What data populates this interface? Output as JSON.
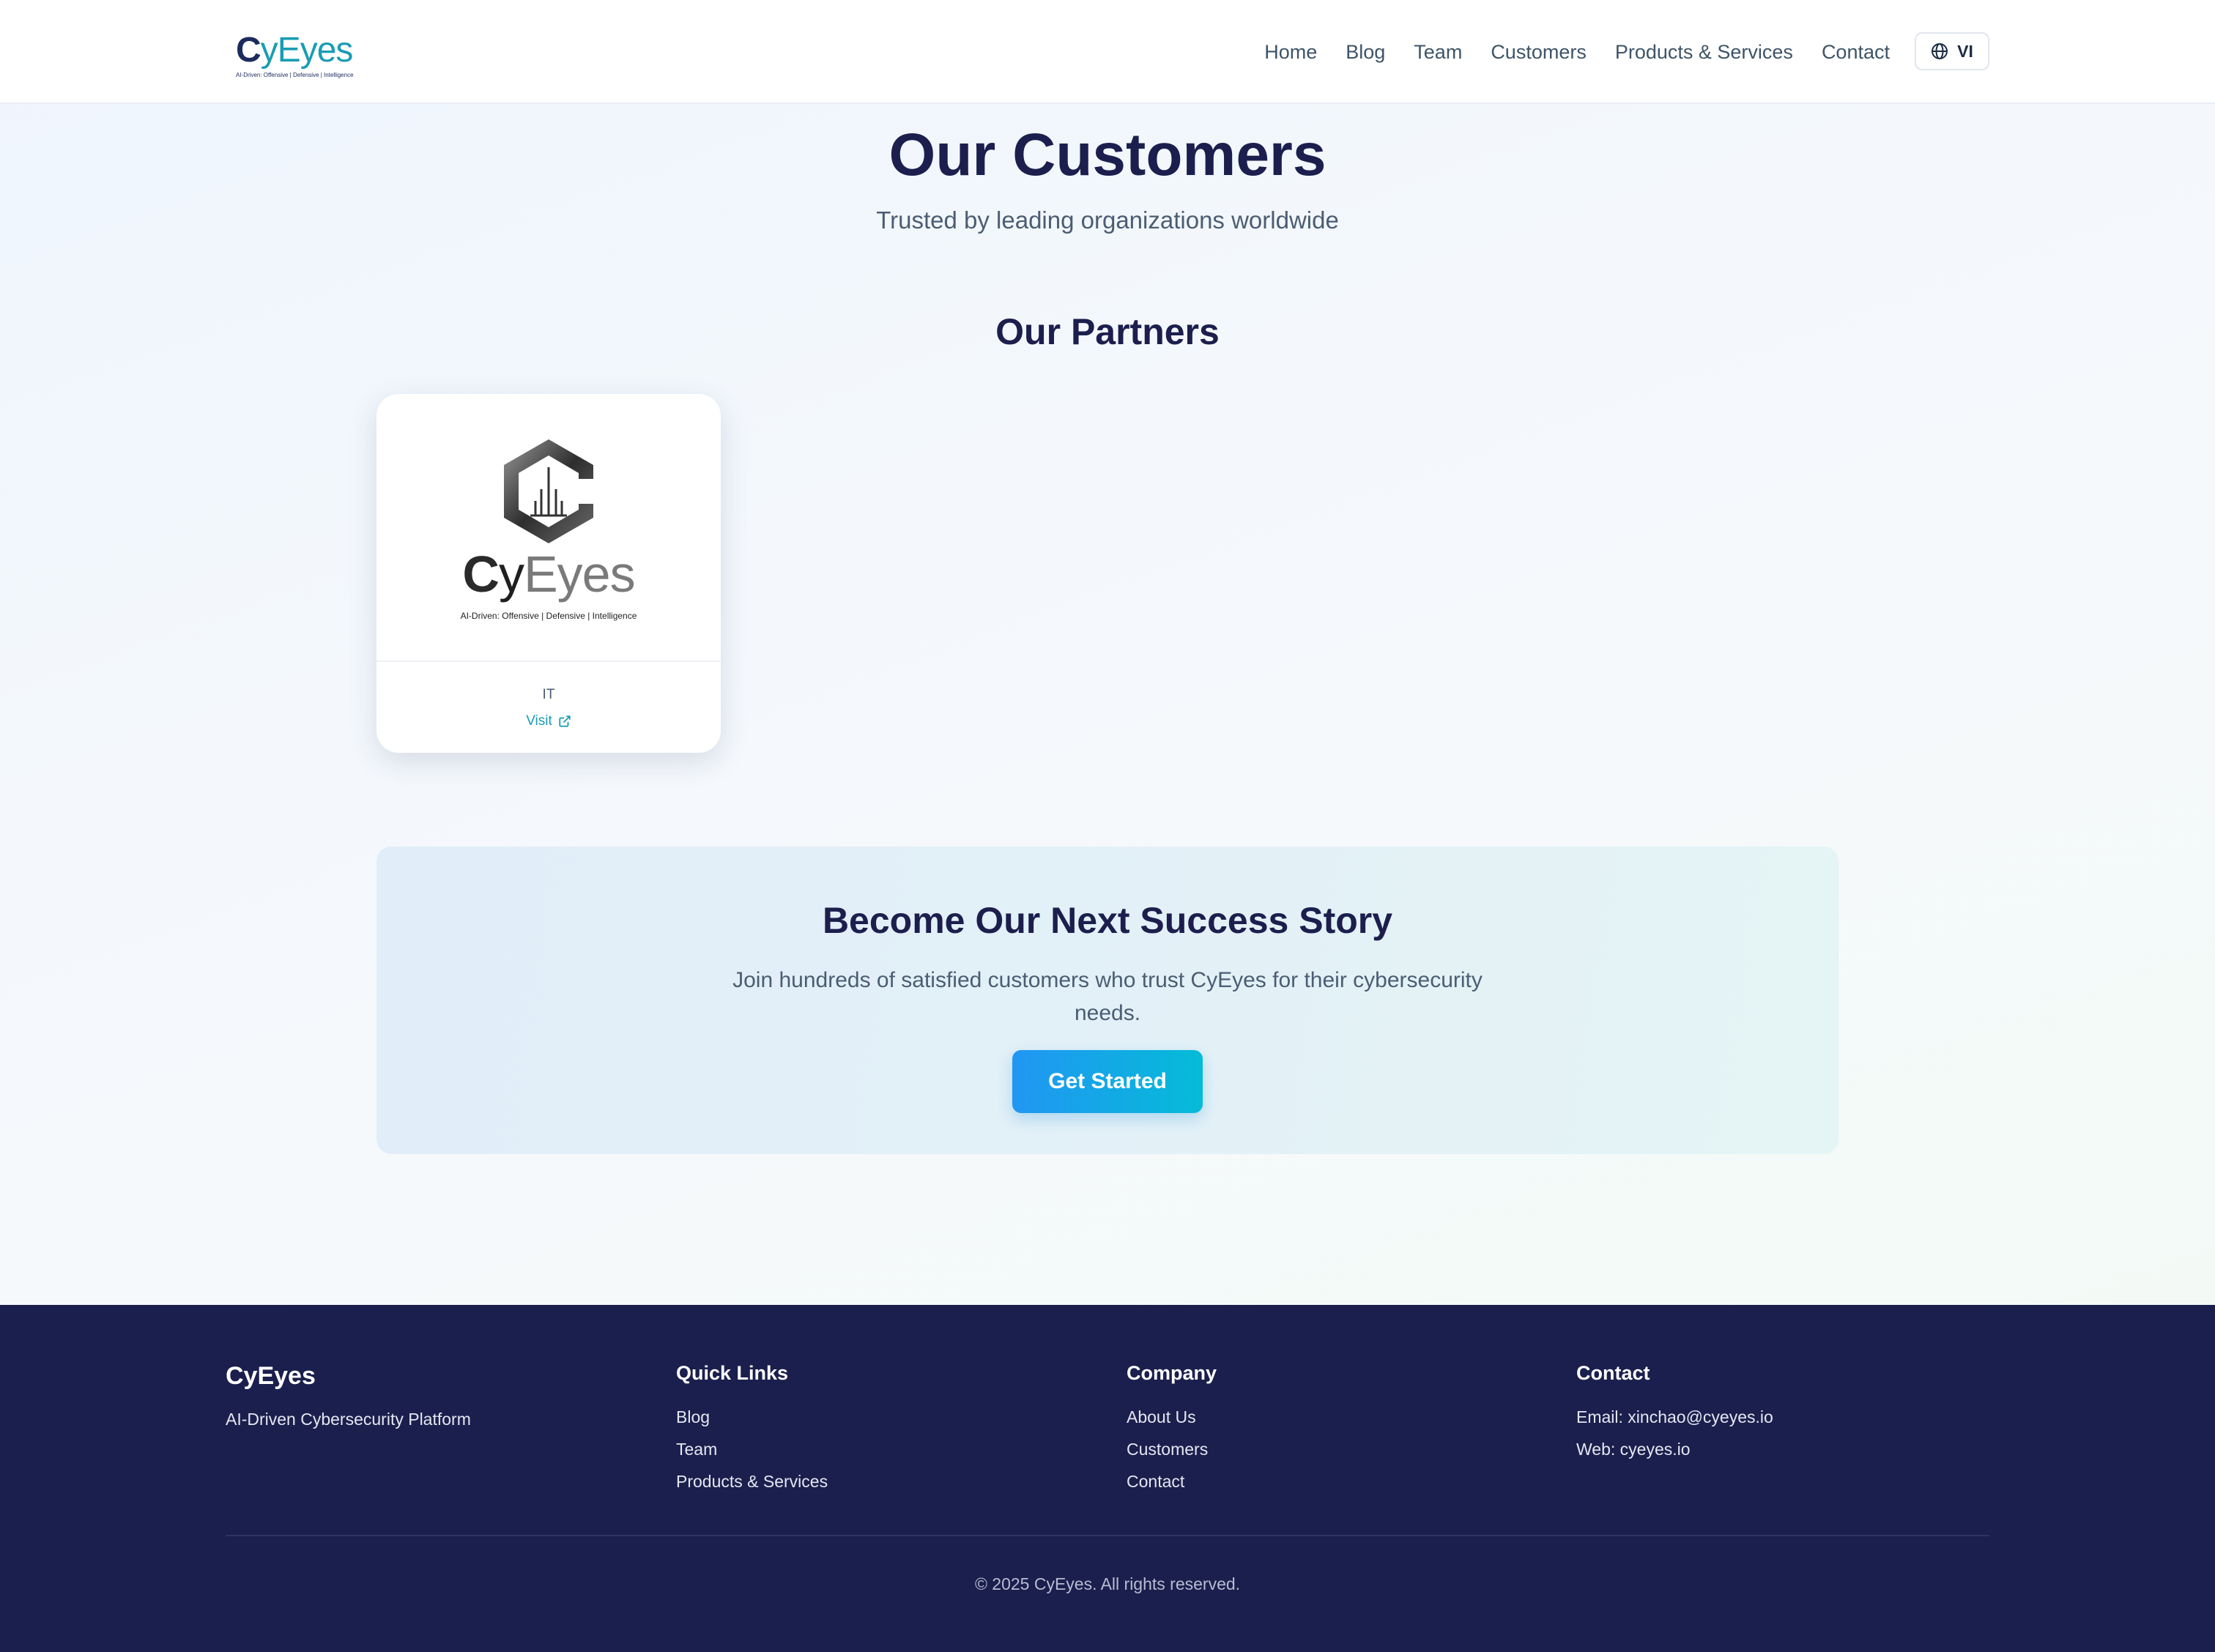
{
  "header": {
    "logo": {
      "text_prefix": "C",
      "text_main": "yEyes",
      "tagline": "AI-Driven: Offensive | Defensive | Intelligence"
    },
    "nav": [
      "Home",
      "Blog",
      "Team",
      "Customers",
      "Products & Services",
      "Contact"
    ],
    "language_button": {
      "label": "VI",
      "icon": "globe-icon"
    }
  },
  "hero": {
    "title": "Our Customers",
    "subtitle": "Trusted by leading organizations worldwide"
  },
  "partners": {
    "heading": "Our Partners",
    "items": [
      {
        "logo_text_prefix": "C",
        "logo_text_y": "y",
        "logo_text_rest": "Eyes",
        "logo_tagline": "AI-Driven: Offensive | Defensive | Intelligence",
        "category": "IT",
        "visit_label": "Visit",
        "visit_icon": "external-link-icon"
      }
    ]
  },
  "cta": {
    "title": "Become Our Next Success Story",
    "text": "Join hundreds of satisfied customers who trust CyEyes for their cybersecurity needs.",
    "button_label": "Get Started"
  },
  "footer": {
    "brand": "CyEyes",
    "brand_sub": "AI-Driven Cybersecurity Platform",
    "quick_links": {
      "heading": "Quick Links",
      "items": [
        "Blog",
        "Team",
        "Products & Services"
      ]
    },
    "company": {
      "heading": "Company",
      "items": [
        "About Us",
        "Customers",
        "Contact"
      ]
    },
    "contact": {
      "heading": "Contact",
      "items": [
        "Email: xinchao@cyeyes.io",
        "Web: cyeyes.io"
      ]
    },
    "copyright": "© 2025 CyEyes. All rights reserved."
  },
  "colors": {
    "navy": "#1c1f4d",
    "teal": "#1a9cb5",
    "footer_bg": "#1b1f4d",
    "button_gradient_start": "#2196f3",
    "button_gradient_end": "#05bbd8"
  }
}
